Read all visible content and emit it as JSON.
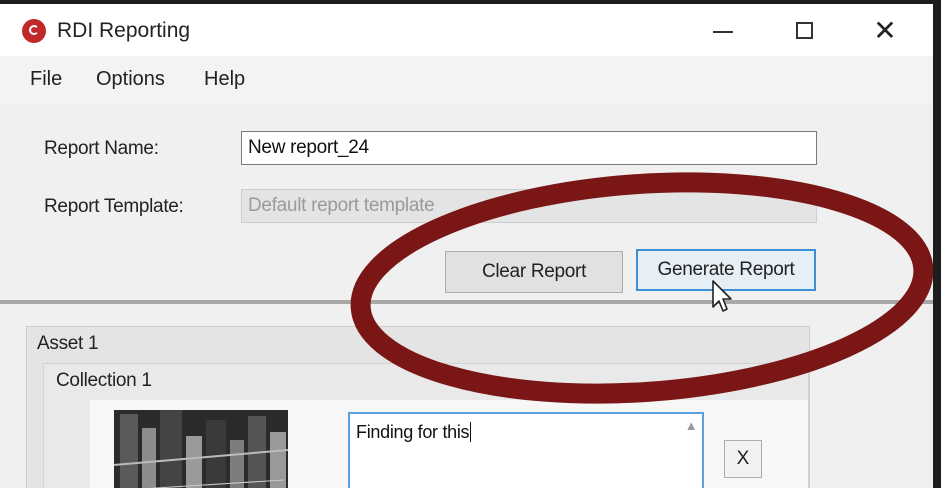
{
  "window": {
    "title": "RDI Reporting",
    "icon": "rdi-app-icon",
    "controls": {
      "minimize": "minimize-icon",
      "maximize": "maximize-icon",
      "close": "✕"
    }
  },
  "menu": {
    "items": [
      {
        "label": "File"
      },
      {
        "label": "Options"
      },
      {
        "label": "Help"
      }
    ]
  },
  "form": {
    "report_name_label": "Report Name:",
    "report_name_value": "New report_24",
    "report_template_label": "Report Template:",
    "report_template_value": "Default report template"
  },
  "actions": {
    "clear_label": "Clear Report",
    "generate_label": "Generate Report"
  },
  "asset": {
    "title": "Asset 1",
    "collection": {
      "title": "Collection 1",
      "finding_text": "Finding for this",
      "remove_label": "X"
    }
  },
  "colors": {
    "highlight": "#7a1616",
    "focus_border": "#3d8fd6",
    "app_icon": "#c0282a"
  }
}
